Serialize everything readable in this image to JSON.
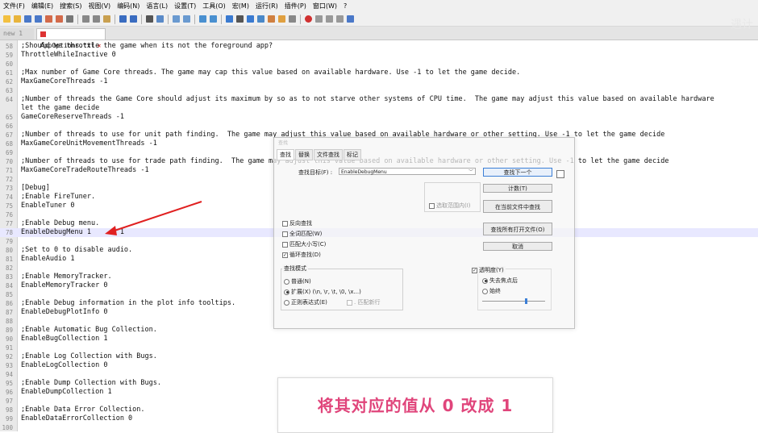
{
  "menubar": [
    "文件(F)",
    "编辑(E)",
    "搜索(S)",
    "视图(V)",
    "编码(N)",
    "语言(L)",
    "设置(T)",
    "工具(O)",
    "宏(M)",
    "运行(R)",
    "插件(P)",
    "窗口(W)",
    "?"
  ],
  "tabs": {
    "inactive": "new 1",
    "active": "AppOptions.txt"
  },
  "watermark": "遇计",
  "colors": {
    "highlight_line": "#e8e8ff",
    "annotation_arrow": "#e02020",
    "caption_text": "#e0457b"
  },
  "editor_lines": [
    {
      "n": "58",
      "t": ";Should we throttle the game when its not the foreground app?"
    },
    {
      "n": "59",
      "t": "ThrottleWhileInactive 0"
    },
    {
      "n": "60",
      "t": ""
    },
    {
      "n": "61",
      "t": ";Max number of Game Core threads. The game may cap this value based on available hardware. Use -1 to let the game decide."
    },
    {
      "n": "62",
      "t": "MaxGameCoreThreads -1"
    },
    {
      "n": "63",
      "t": ""
    },
    {
      "n": "64",
      "t": ";Number of threads the Game Core should adjust its maximum by so as to not starve other systems of CPU time.  The game may adjust this value based on available hardware"
    },
    {
      "n": "",
      "t": "let the game decide"
    },
    {
      "n": "65",
      "t": "GameCoreReserveThreads -1"
    },
    {
      "n": "66",
      "t": ""
    },
    {
      "n": "67",
      "t": ";Number of threads to use for unit path finding.  The game may adjust this value based on available hardware or other setting. Use -1 to let the game decide"
    },
    {
      "n": "68",
      "t": "MaxGameCoreUnitMovementThreads -1"
    },
    {
      "n": "69",
      "t": ""
    },
    {
      "n": "70",
      "t": ";Number of threads to use for trade path finding.  The game may adjust this value based on available hardware or other setting. Use -1 to let the game decide"
    },
    {
      "n": "71",
      "t": "MaxGameCoreTradeRouteThreads -1"
    },
    {
      "n": "72",
      "t": ""
    },
    {
      "n": "73",
      "t": "[Debug]"
    },
    {
      "n": "74",
      "t": ";Enable FireTuner."
    },
    {
      "n": "75",
      "t": "EnableTuner 0"
    },
    {
      "n": "76",
      "t": ""
    },
    {
      "n": "77",
      "t": ";Enable Debug menu."
    },
    {
      "n": "78",
      "t": "EnableDebugMenu 1       1"
    },
    {
      "n": "79",
      "t": ""
    },
    {
      "n": "80",
      "t": ";Set to 0 to disable audio."
    },
    {
      "n": "81",
      "t": "EnableAudio 1"
    },
    {
      "n": "82",
      "t": ""
    },
    {
      "n": "83",
      "t": ";Enable MemoryTracker."
    },
    {
      "n": "84",
      "t": "EnableMemoryTracker 0"
    },
    {
      "n": "85",
      "t": ""
    },
    {
      "n": "86",
      "t": ";Enable Debug information in the plot info tooltips."
    },
    {
      "n": "87",
      "t": "EnableDebugPlotInfo 0"
    },
    {
      "n": "88",
      "t": ""
    },
    {
      "n": "89",
      "t": ";Enable Automatic Bug Collection."
    },
    {
      "n": "90",
      "t": "EnableBugCollection 1"
    },
    {
      "n": "91",
      "t": ""
    },
    {
      "n": "92",
      "t": ";Enable Log Collection with Bugs."
    },
    {
      "n": "93",
      "t": "EnableLogCollection 0"
    },
    {
      "n": "94",
      "t": ""
    },
    {
      "n": "95",
      "t": ";Enable Dump Collection with Bugs."
    },
    {
      "n": "96",
      "t": "EnableDumpCollection 1"
    },
    {
      "n": "97",
      "t": ""
    },
    {
      "n": "98",
      "t": ";Enable Data Error Collection."
    },
    {
      "n": "99",
      "t": "EnableDataErrorCollection 0"
    },
    {
      "n": "100",
      "t": ""
    }
  ],
  "highlight_line_index": 21,
  "find_dialog": {
    "title": "查找",
    "tabs": [
      "查找",
      "替换",
      "文件查找",
      "标记"
    ],
    "target_label": "查找目标(F) :",
    "target_value": "EnableDebugMenu",
    "buttons": {
      "find_next": "查找下一个",
      "count": "计数(T)",
      "find_in_current": "在当前文件中查找",
      "find_in_all_open": "查找所有打开文件(O)",
      "cancel": "取消"
    },
    "selection_scope": "选取范围内(I)",
    "options": [
      {
        "label": "反向查找",
        "checked": false
      },
      {
        "label": "全词匹配(W)",
        "checked": false
      },
      {
        "label": "匹配大小写(C)",
        "checked": false
      },
      {
        "label": "循环查找(D)",
        "checked": true
      }
    ],
    "search_mode": {
      "title": "查找模式",
      "options": [
        "普通(N)",
        "扩展(X) (\\n, \\r, \\t, \\0, \\x...)",
        "正则表达式(E)"
      ],
      "selected": 1,
      "dot_matches_newline": ". 匹配新行"
    },
    "transparency": {
      "label": "透明度(Y)",
      "checked": true,
      "options": [
        "失去焦点后",
        "始终"
      ],
      "selected": 0,
      "level": 0.7
    }
  },
  "caption": "将其对应的值从 0 改成 1"
}
